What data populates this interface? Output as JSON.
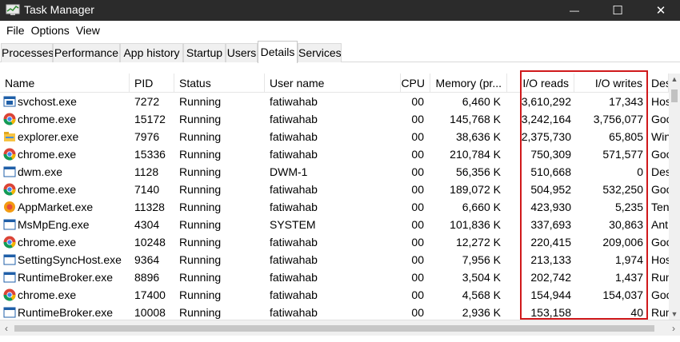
{
  "window": {
    "title": "Task Manager",
    "minimize": "—",
    "maximize": "☐",
    "close": "✕"
  },
  "menu": [
    "File",
    "Options",
    "View"
  ],
  "tabs": [
    {
      "label": "Processes",
      "active": false
    },
    {
      "label": "Performance",
      "active": false
    },
    {
      "label": "App history",
      "active": false
    },
    {
      "label": "Startup",
      "active": false
    },
    {
      "label": "Users",
      "active": false
    },
    {
      "label": "Details",
      "active": true
    },
    {
      "label": "Services",
      "active": false
    }
  ],
  "columns": {
    "name": "Name",
    "pid": "PID",
    "status": "Status",
    "user": "User name",
    "cpu": "CPU",
    "memory": "Memory (pr...",
    "io_reads": "I/O reads",
    "io_writes": "I/O writes",
    "description": "Des"
  },
  "highlight_color": "#d0191b",
  "rows": [
    {
      "name": "svchost.exe",
      "icon": "service-host-icon",
      "pid": "7272",
      "status": "Running",
      "user": "fatiwahab",
      "cpu": "00",
      "memory": "6,460 K",
      "io_reads": "3,610,292",
      "io_writes": "17,343",
      "desc": "Hos"
    },
    {
      "name": "chrome.exe",
      "icon": "chrome-icon",
      "pid": "15172",
      "status": "Running",
      "user": "fatiwahab",
      "cpu": "00",
      "memory": "145,768 K",
      "io_reads": "3,242,164",
      "io_writes": "3,756,077",
      "desc": "Goo"
    },
    {
      "name": "explorer.exe",
      "icon": "folder-icon",
      "pid": "7976",
      "status": "Running",
      "user": "fatiwahab",
      "cpu": "00",
      "memory": "38,636 K",
      "io_reads": "2,375,730",
      "io_writes": "65,805",
      "desc": "Win"
    },
    {
      "name": "chrome.exe",
      "icon": "chrome-icon",
      "pid": "15336",
      "status": "Running",
      "user": "fatiwahab",
      "cpu": "00",
      "memory": "210,784 K",
      "io_reads": "750,309",
      "io_writes": "571,577",
      "desc": "Goo"
    },
    {
      "name": "dwm.exe",
      "icon": "window-icon",
      "pid": "1128",
      "status": "Running",
      "user": "DWM-1",
      "cpu": "00",
      "memory": "56,356 K",
      "io_reads": "510,668",
      "io_writes": "0",
      "desc": "Des"
    },
    {
      "name": "chrome.exe",
      "icon": "chrome-icon",
      "pid": "7140",
      "status": "Running",
      "user": "fatiwahab",
      "cpu": "00",
      "memory": "189,072 K",
      "io_reads": "504,952",
      "io_writes": "532,250",
      "desc": "Goo"
    },
    {
      "name": "AppMarket.exe",
      "icon": "app-market-icon",
      "pid": "11328",
      "status": "Running",
      "user": "fatiwahab",
      "cpu": "00",
      "memory": "6,660 K",
      "io_reads": "423,930",
      "io_writes": "5,235",
      "desc": "Ten"
    },
    {
      "name": "MsMpEng.exe",
      "icon": "window-icon",
      "pid": "4304",
      "status": "Running",
      "user": "SYSTEM",
      "cpu": "00",
      "memory": "101,836 K",
      "io_reads": "337,693",
      "io_writes": "30,863",
      "desc": "Ant"
    },
    {
      "name": "chrome.exe",
      "icon": "chrome-icon",
      "pid": "10248",
      "status": "Running",
      "user": "fatiwahab",
      "cpu": "00",
      "memory": "12,272 K",
      "io_reads": "220,415",
      "io_writes": "209,006",
      "desc": "Goo"
    },
    {
      "name": "SettingSyncHost.exe",
      "icon": "window-icon",
      "pid": "9364",
      "status": "Running",
      "user": "fatiwahab",
      "cpu": "00",
      "memory": "7,956 K",
      "io_reads": "213,133",
      "io_writes": "1,974",
      "desc": "Hos"
    },
    {
      "name": "RuntimeBroker.exe",
      "icon": "window-icon",
      "pid": "8896",
      "status": "Running",
      "user": "fatiwahab",
      "cpu": "00",
      "memory": "3,504 K",
      "io_reads": "202,742",
      "io_writes": "1,437",
      "desc": "Run"
    },
    {
      "name": "chrome.exe",
      "icon": "chrome-icon",
      "pid": "17400",
      "status": "Running",
      "user": "fatiwahab",
      "cpu": "00",
      "memory": "4,568 K",
      "io_reads": "154,944",
      "io_writes": "154,037",
      "desc": "Goo"
    },
    {
      "name": "RuntimeBroker.exe",
      "icon": "window-icon",
      "pid": "10008",
      "status": "Running",
      "user": "fatiwahab",
      "cpu": "00",
      "memory": "2,936 K",
      "io_reads": "153,158",
      "io_writes": "40",
      "desc": "Run"
    }
  ]
}
